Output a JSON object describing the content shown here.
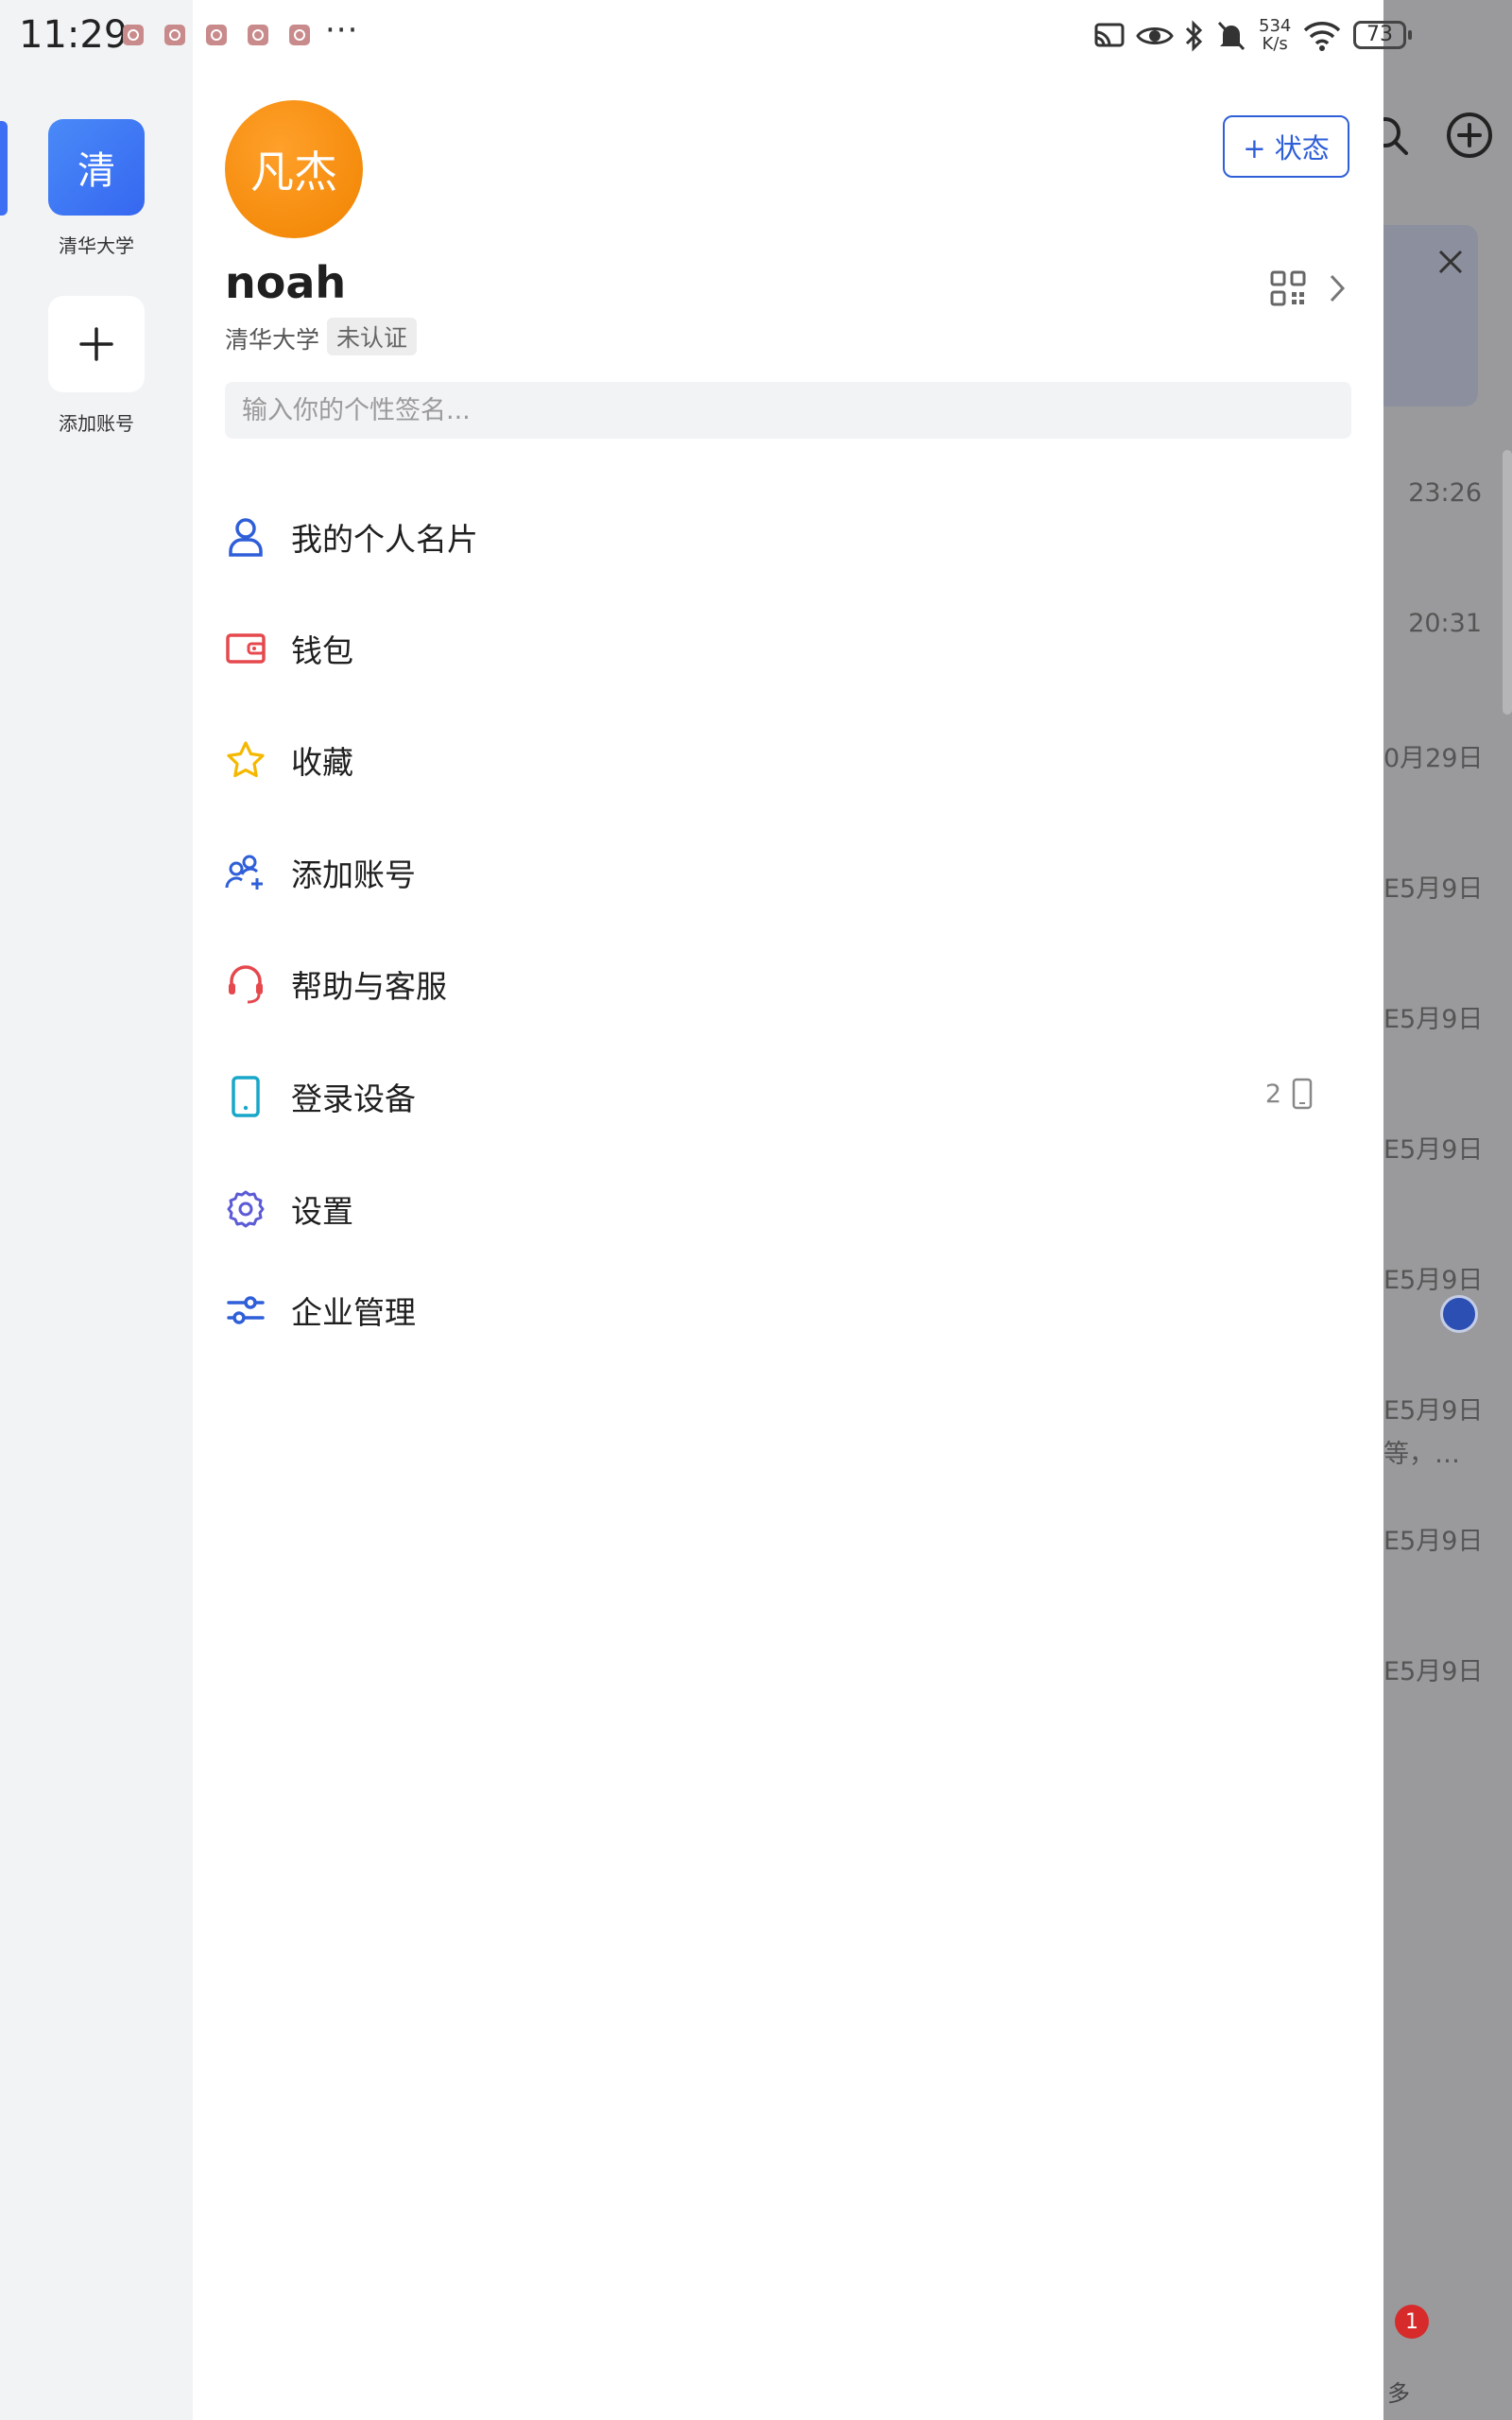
{
  "status_bar": {
    "time": "11:29",
    "more": "···",
    "net_speed_value": "534",
    "net_speed_unit": "K/s",
    "battery": "73"
  },
  "rail": {
    "account_initial": "清",
    "account_name": "清华大学",
    "add_account_label": "添加账号"
  },
  "profile": {
    "avatar_text": "凡杰",
    "status_button": "+ 状态",
    "username": "noah",
    "organization": "清华大学",
    "verification_badge": "未认证",
    "signature_placeholder": "输入你的个性签名..."
  },
  "menu": {
    "items": [
      {
        "label": "我的个人名片",
        "icon": "person-icon",
        "color": "#2f5fd8"
      },
      {
        "label": "钱包",
        "icon": "wallet-icon",
        "color": "#e5484d"
      },
      {
        "label": "收藏",
        "icon": "star-icon",
        "color": "#f5b800"
      },
      {
        "label": "添加账号",
        "icon": "add-account-icon",
        "color": "#2f5fd8"
      },
      {
        "label": "帮助与客服",
        "icon": "headset-icon",
        "color": "#e5484d"
      },
      {
        "label": "登录设备",
        "icon": "phone-icon",
        "color": "#19a7c9"
      },
      {
        "label": "设置",
        "icon": "gear-icon",
        "color": "#5b5bd6"
      },
      {
        "label": "企业管理",
        "icon": "sliders-icon",
        "color": "#2f5fd8"
      }
    ],
    "device_count": "2"
  },
  "background": {
    "times": [
      "23:26",
      "20:31",
      "0月29日",
      "E5月9日",
      "E5月9日",
      "E5月9日",
      "E5月9日",
      "E5月9日",
      "E5月9日",
      "E5月9日"
    ],
    "preview": "等，…",
    "unread_badge": "1",
    "more_label": "多"
  }
}
